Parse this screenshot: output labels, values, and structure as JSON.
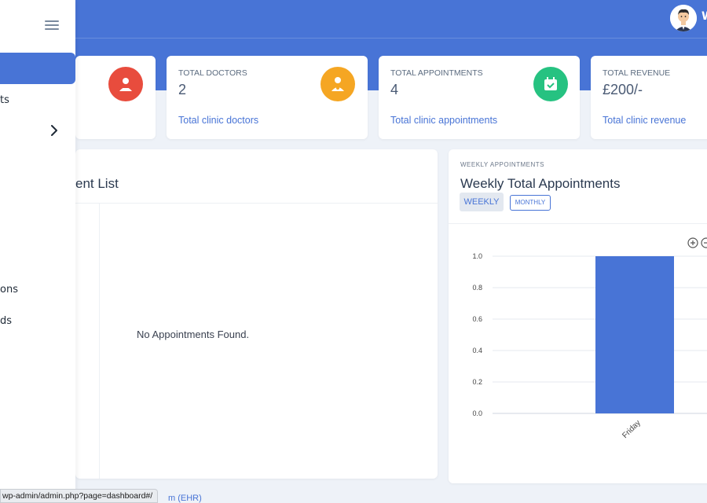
{
  "header": {
    "user_initial": "W"
  },
  "sidebar": {
    "items": [
      {
        "label": "ts"
      },
      {
        "label": ""
      },
      {
        "label": "ons"
      },
      {
        "label": "ds"
      }
    ]
  },
  "stats": [
    {
      "title": "",
      "value": "",
      "subtitle": "",
      "icon": "patient-icon",
      "color": "#e84c3d"
    },
    {
      "title": "TOTAL DOCTORS",
      "value": "2",
      "subtitle": "Total clinic doctors",
      "icon": "doctor-icon",
      "color": "#f5a623"
    },
    {
      "title": "TOTAL APPOINTMENTS",
      "value": "4",
      "subtitle": "Total clinic appointments",
      "icon": "calendar-check-icon",
      "color": "#26c281"
    },
    {
      "title": "TOTAL REVENUE",
      "value": "£200/-",
      "subtitle": "Total clinic revenue"
    }
  ],
  "appointments_panel": {
    "title": "ent List",
    "empty_message": "No Appointments Found."
  },
  "weekly_panel": {
    "eyebrow": "WEEKLY APPOINTMENTS",
    "title": "Weekly Total Appointments",
    "tab_weekly": "WEEKLY",
    "tab_monthly": "MONTHLY"
  },
  "chart_data": {
    "type": "bar",
    "categories": [
      "Friday"
    ],
    "values": [
      1
    ],
    "ylim": [
      0,
      1
    ],
    "yticks": [
      "1.0",
      "0.8",
      "0.6",
      "0.4",
      "0.2",
      "0.0"
    ],
    "bar_color": "#4874d6",
    "grid": true
  },
  "status_bar": {
    "url": "wp-admin/admin.php?page=dashboard#/"
  },
  "footer": {
    "link_text": "m (EHR)"
  }
}
